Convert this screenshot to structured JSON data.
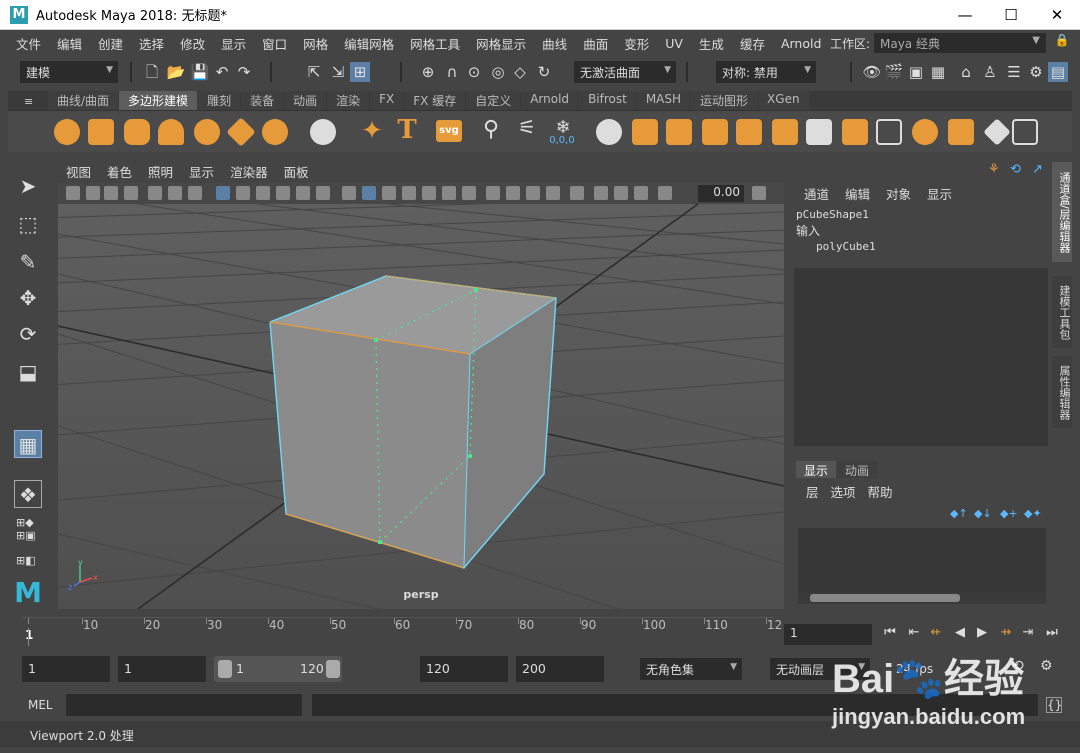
{
  "window": {
    "title": "Autodesk Maya 2018: 无标题*",
    "logo": "M",
    "minimize": "—",
    "maximize": "☐",
    "close": "✕"
  },
  "menubar": {
    "items": [
      "文件",
      "编辑",
      "创建",
      "选择",
      "修改",
      "显示",
      "窗口",
      "网格",
      "编辑网格",
      "网格工具",
      "网格显示",
      "曲线",
      "曲面",
      "变形",
      "UV",
      "生成",
      "缓存",
      "Arnold"
    ],
    "workspace_label": "工作区:",
    "workspace_value": "Maya 经典"
  },
  "statusline": {
    "mode": "建模",
    "live_surface": "无激活曲面",
    "symmetry": "对称: 禁用"
  },
  "shelf": {
    "tabs": [
      "曲线/曲面",
      "多边形建模",
      "雕刻",
      "装备",
      "动画",
      "渲染",
      "FX",
      "FX 缓存",
      "自定义",
      "Arnold",
      "Bifrost",
      "MASH",
      "运动图形",
      "XGen"
    ],
    "active_tab": 1,
    "text_tool": "T",
    "svg_tool": "svg",
    "coord_label": "0,0,0"
  },
  "viewport": {
    "menu": [
      "视图",
      "着色",
      "照明",
      "显示",
      "渲染器",
      "面板"
    ],
    "value": "0.00",
    "camera_label": "persp",
    "axis_x": "x",
    "axis_y": "y",
    "axis_z": "z"
  },
  "channelbox": {
    "menu": [
      "通道",
      "编辑",
      "对象",
      "显示"
    ],
    "shape_name": "pCubeShape1",
    "inputs_label": "输入",
    "input_name": "polyCube1"
  },
  "layers": {
    "tabs": [
      "显示",
      "动画"
    ],
    "menu": [
      "层",
      "选项",
      "帮助"
    ]
  },
  "sidetabs": [
    "通道盒/层编辑器",
    "建模工具包",
    "属性编辑器"
  ],
  "timeslider": {
    "ticks": [
      "1",
      "10",
      "20",
      "30",
      "40",
      "50",
      "60",
      "70",
      "80",
      "90",
      "100",
      "110",
      "12"
    ],
    "current_frame": "1"
  },
  "range": {
    "start": "1",
    "playback_start": "1",
    "bar_start": "1",
    "bar_end": "120",
    "playback_end": "120",
    "end": "200",
    "char_set": "无角色集",
    "anim_layer": "无动画层",
    "fps": "24 fps"
  },
  "cmdline": {
    "label": "MEL"
  },
  "helpline": {
    "text": "Viewport 2.0 处理"
  },
  "watermark": {
    "brand": "Bai🐾经验",
    "url": "jingyan.baidu.com"
  },
  "colors": {
    "accent_orange": "#e79a3a",
    "selection_cyan": "#6fd9f5",
    "maya_teal": "#2a9db0"
  }
}
